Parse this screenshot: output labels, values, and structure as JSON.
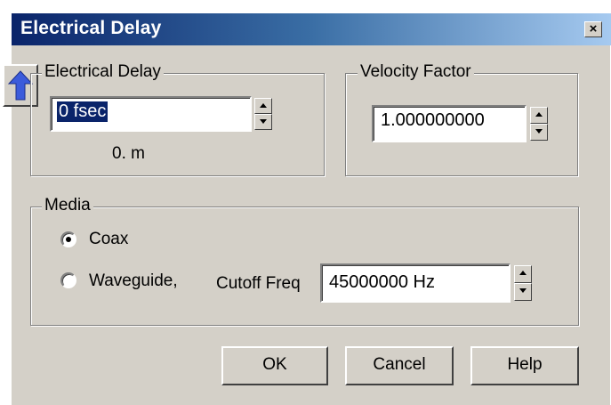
{
  "window": {
    "title": "Electrical Delay",
    "close_glyph": "×"
  },
  "electrical_delay": {
    "group_label": "Electrical Delay",
    "value": "0 fsec",
    "length_readout": "0. m",
    "move_icon": "up-arrow-icon"
  },
  "velocity_factor": {
    "group_label": "Velocity Factor",
    "value": "1.000000000"
  },
  "media": {
    "group_label": "Media",
    "options": [
      {
        "label": "Coax",
        "selected": true
      },
      {
        "label": "Waveguide,",
        "selected": false
      }
    ],
    "cutoff_label": "Cutoff Freq",
    "cutoff_value": "45000000 Hz"
  },
  "buttons": {
    "ok": "OK",
    "cancel": "Cancel",
    "help": "Help"
  },
  "colors": {
    "title_start": "#0a246a",
    "title_end": "#a6caf0",
    "face": "#d4d0c8",
    "arrow": "#3b5bdb"
  }
}
